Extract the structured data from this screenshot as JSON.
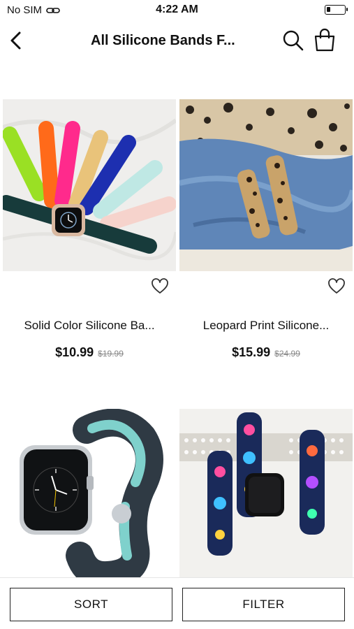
{
  "status_bar": {
    "carrier": "No SIM",
    "time": "4:22 AM"
  },
  "nav": {
    "title": "All Silicone Bands F..."
  },
  "products": [
    {
      "name": "Solid Color Silicone Ba...",
      "price": "$10.99",
      "old_price": "$19.99"
    },
    {
      "name": "Leopard Print Silicone...",
      "price": "$15.99",
      "old_price": "$24.99"
    },
    {
      "name": "",
      "price": "",
      "old_price": ""
    },
    {
      "name": "",
      "price": "",
      "old_price": ""
    }
  ],
  "bottom_bar": {
    "sort_label": "SORT",
    "filter_label": "FILTER"
  }
}
